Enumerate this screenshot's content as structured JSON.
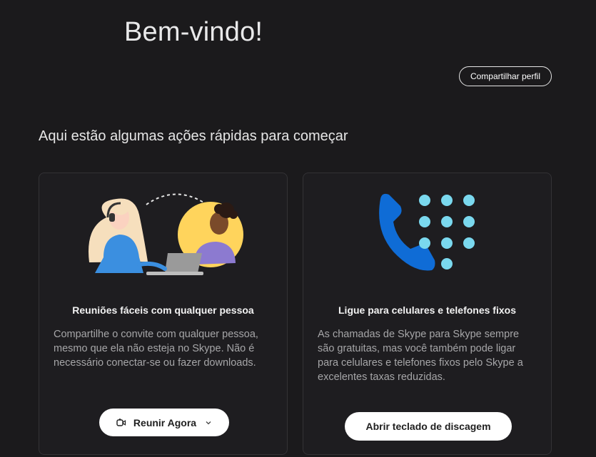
{
  "header": {
    "title": "Bem-vindo!",
    "share_profile_label": "Compartilhar perfil"
  },
  "quick_actions": {
    "heading": "Aqui estão algumas ações rápidas para começar",
    "cards": [
      {
        "title": "Reuniões fáceis com qualquer pessoa",
        "description": "Compartilhe o convite com qualquer pessoa, mesmo que ela não esteja no Skype. Não é necessário conectar-se ou fazer downloads.",
        "button_label": "Reunir Agora",
        "button_icon": "video-camera-icon",
        "dropdown_icon": "chevron-down-icon"
      },
      {
        "title": "Ligue para celulares e telefones fixos",
        "description": "As chamadas de Skype para Skype sempre são gratuitas, mas você também pode ligar para celulares e telefones fixos pelo Skype a excelentes taxas reduzidas.",
        "button_label": "Abrir teclado de discagem"
      }
    ]
  },
  "colors": {
    "background": "#1b1a1c",
    "card_background": "#1e1d20",
    "phone_blue": "#0f6cd6",
    "dot_cyan": "#7ad8ee",
    "circle_yellow": "#ffd45c"
  }
}
